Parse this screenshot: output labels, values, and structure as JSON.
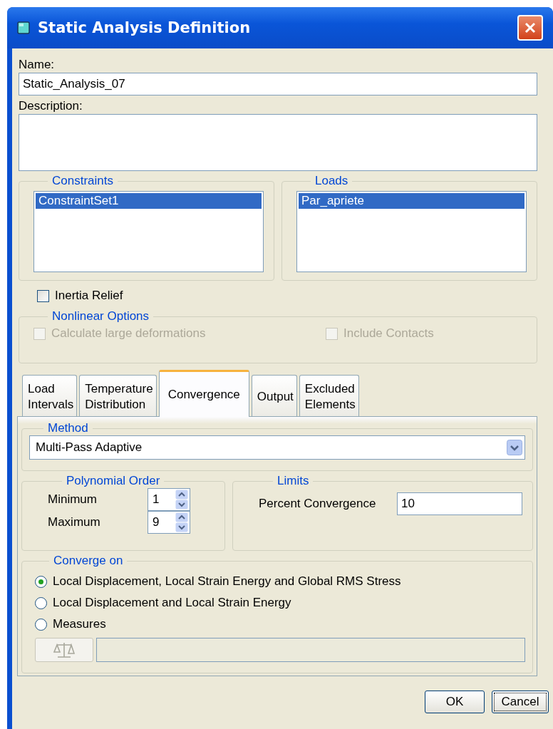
{
  "window": {
    "title": "Static Analysis Definition"
  },
  "name": {
    "label": "Name:",
    "value": "Static_Analysis_07"
  },
  "description": {
    "label": "Description:"
  },
  "constraints": {
    "title": "Constraints",
    "items": [
      {
        "label": "ConstraintSet1",
        "selected": true
      }
    ]
  },
  "loads": {
    "title": "Loads",
    "items": [
      {
        "label": "Par_apriete",
        "selected": true
      }
    ]
  },
  "inertia_relief": {
    "label": "Inertia Relief",
    "checked": false
  },
  "nonlinear_options": {
    "title": "Nonlinear Options",
    "disabled": true,
    "options": [
      {
        "label": "Calculate large deformations",
        "checked": false
      },
      {
        "label": "Include Contacts",
        "checked": false
      }
    ]
  },
  "tabs": [
    {
      "label": "Load\nIntervals",
      "selected": false
    },
    {
      "label": "Temperature\nDistribution",
      "selected": false
    },
    {
      "label": "Convergence",
      "selected": true
    },
    {
      "label": "Output",
      "selected": false
    },
    {
      "label": "Excluded\nElements",
      "selected": false
    }
  ],
  "method": {
    "title": "Method",
    "value": "Multi-Pass Adaptive"
  },
  "polynomial_order": {
    "title": "Polynomial Order",
    "fields": [
      {
        "label": "Minimum",
        "value": "1"
      },
      {
        "label": "Maximum",
        "value": "9"
      }
    ]
  },
  "limits": {
    "title": "Limits",
    "fields": [
      {
        "label": "Percent Convergence",
        "value": "10"
      }
    ]
  },
  "converge_on": {
    "title": "Converge on",
    "options": [
      {
        "label": "Local Displacement, Local Strain Energy and Global RMS Stress",
        "selected": true
      },
      {
        "label": "Local Displacement and Local Strain Energy",
        "selected": false
      },
      {
        "label": "Measures",
        "selected": false
      }
    ],
    "measures": {
      "disabled": true
    }
  },
  "buttons": [
    {
      "label": "OK",
      "focused": false
    },
    {
      "label": "Cancel",
      "focused": true
    }
  ]
}
